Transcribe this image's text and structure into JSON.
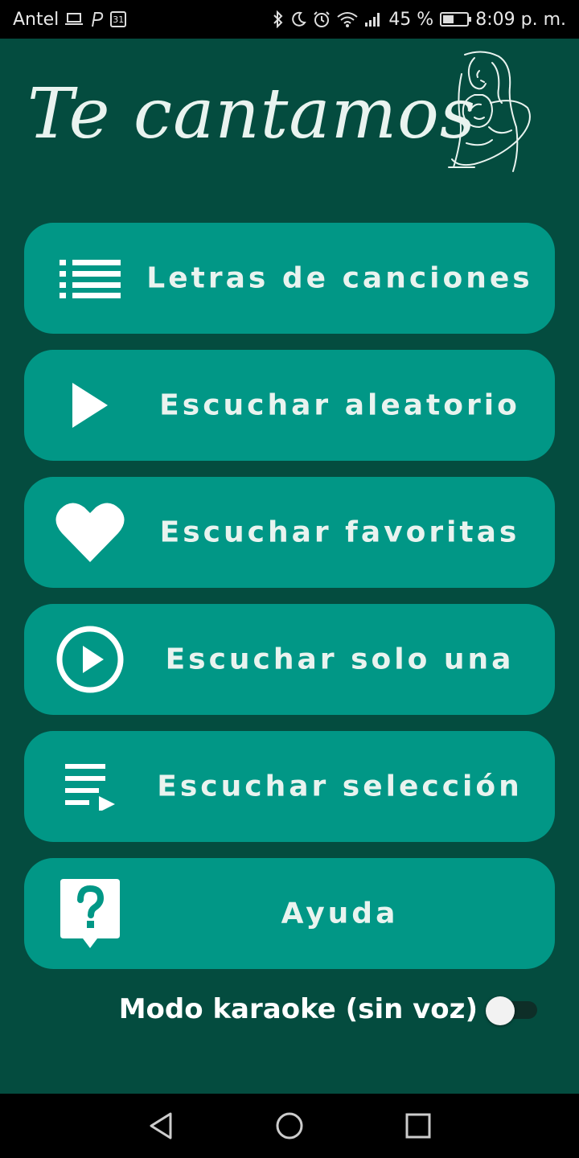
{
  "status_bar": {
    "carrier": "Antel",
    "calendar_day": "31",
    "battery_percent": "45 %",
    "battery_level": 0.45,
    "time": "8:09 p. m."
  },
  "header": {
    "title": "Te cantamos",
    "logo_icon": "mother-holding-baby-line-art"
  },
  "menu": {
    "items": [
      {
        "label": "Letras de canciones",
        "icon": "list-icon"
      },
      {
        "label": "Escuchar aleatorio",
        "icon": "play-triangle-icon"
      },
      {
        "label": "Escuchar favoritas",
        "icon": "heart-icon"
      },
      {
        "label": "Escuchar solo una",
        "icon": "play-circle-icon"
      },
      {
        "label": "Escuchar selección",
        "icon": "playlist-play-icon"
      },
      {
        "label": "Ayuda",
        "icon": "help-bubble-icon"
      }
    ]
  },
  "karaoke": {
    "label": "Modo karaoke (sin voz)",
    "enabled": false
  },
  "colors": {
    "background": "#044c3f",
    "button": "#019786",
    "text": "#e9f3ef"
  },
  "nav_bar": {
    "buttons": [
      "back-icon",
      "home-icon",
      "recents-icon"
    ]
  }
}
